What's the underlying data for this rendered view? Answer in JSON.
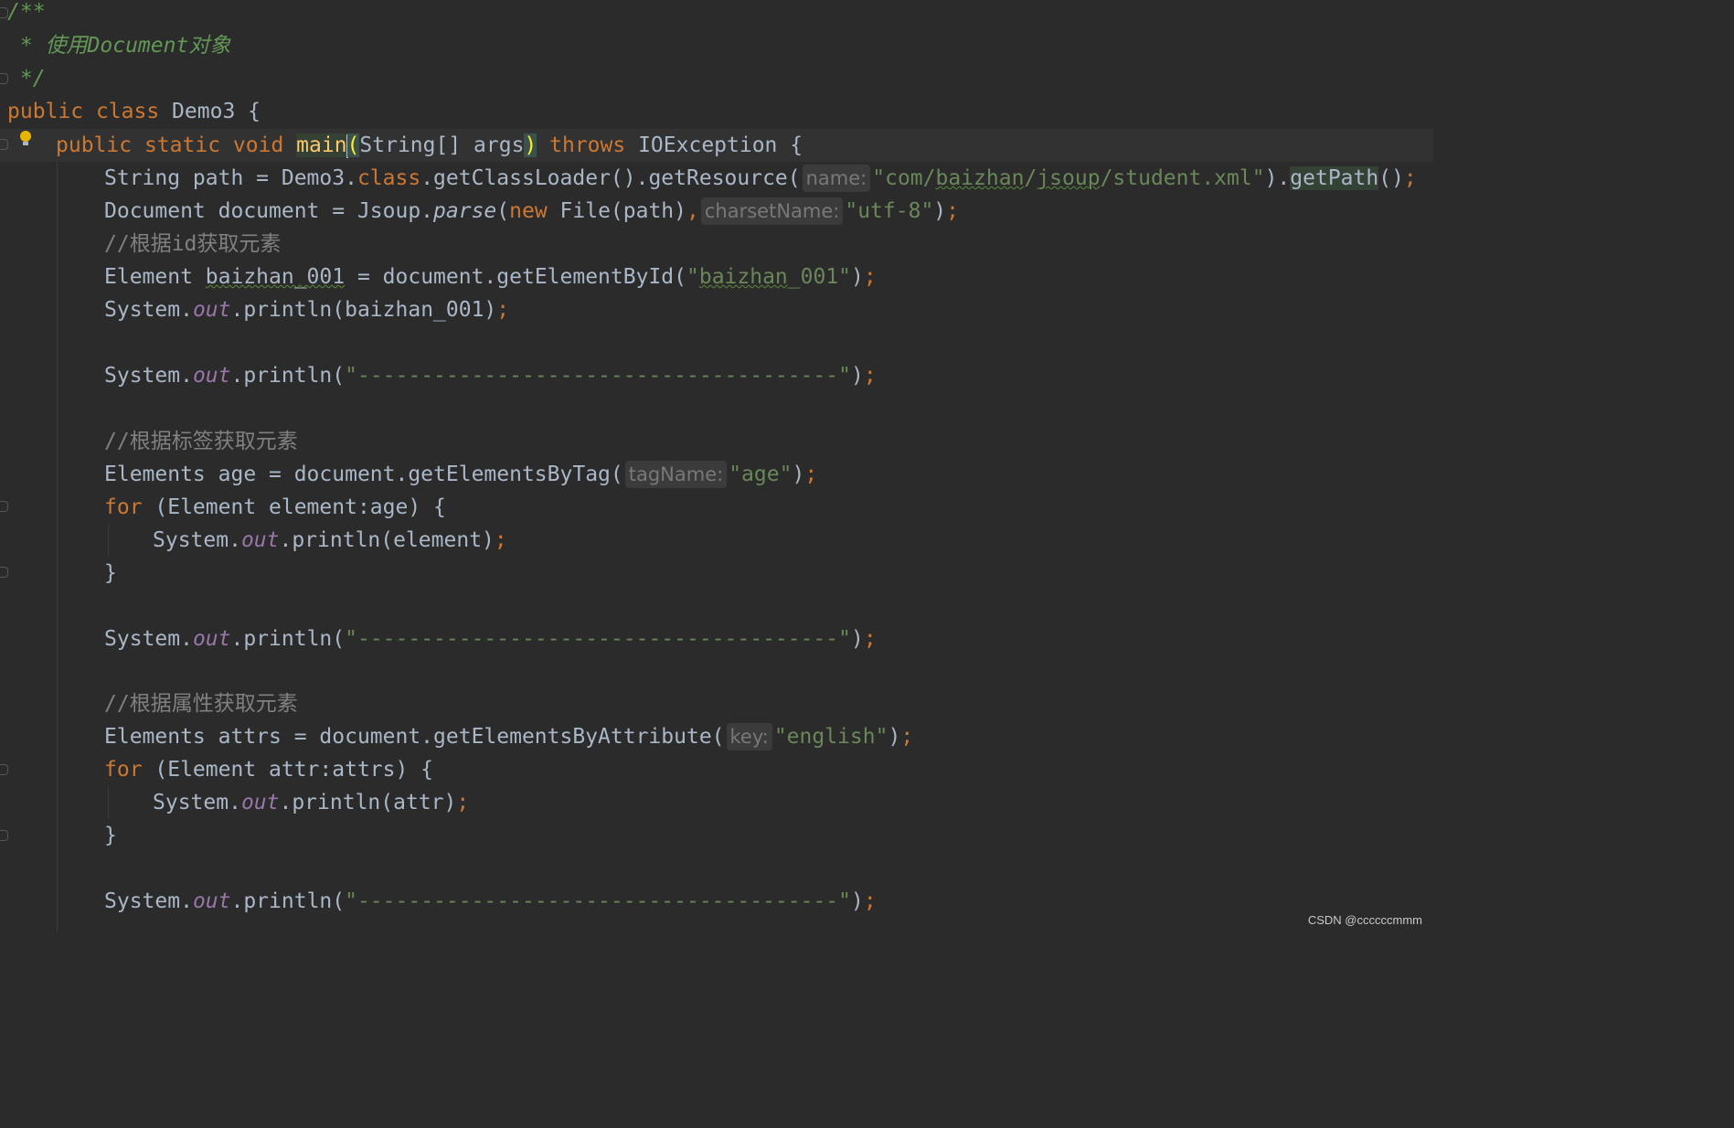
{
  "lines": {
    "l1": "/**",
    "l2": " * 使用Document对象",
    "l3": " */",
    "l4_kw1": "public",
    "l4_kw2": "class",
    "l4_rest": " Demo3 {",
    "l5_kw1": "public",
    "l5_kw2": "static",
    "l5_kw3": "void",
    "l5_method": "main",
    "l5_open": "(",
    "l5_params": "String[] args",
    "l5_close": ")",
    "l5_throws": "throws",
    "l5_rest": " IOException {",
    "l6_a": "String path = Demo3.",
    "l6_class": "class",
    "l6_b": ".getClassLoader().getResource(",
    "l6_hint": "name:",
    "l6_str_a": "\"com/",
    "l6_str_b": "baizhan",
    "l6_str_c": "/",
    "l6_str_d": "jsoup",
    "l6_str_e": "/student.xml\"",
    "l6_c": ").",
    "l6_getpath": "getPath",
    "l6_d": "()",
    "l6_semi": ";",
    "l7_a": "Document document = Jsoup.",
    "l7_parse": "parse",
    "l7_b": "(",
    "l7_new": "new",
    "l7_c": " File(path)",
    "l7_comma": ",",
    "l7_hint": "charsetName:",
    "l7_str": "\"utf-8\"",
    "l7_d": ")",
    "l7_semi": ";",
    "l8": "//根据id获取元素",
    "l9_a": "Element ",
    "l9_var": "baizhan_001",
    "l9_b": " = document.getElementById(",
    "l9_str_a": "\"",
    "l9_str_b": "baizhan",
    "l9_str_c": "_001\"",
    "l9_c": ")",
    "l9_semi": ";",
    "l10_a": "System.",
    "l10_out": "out",
    "l10_b": ".println(baizhan_001)",
    "l10_semi": ";",
    "l12_a": "System.",
    "l12_out": "out",
    "l12_b": ".println(",
    "l12_str": "\"--------------------------------------\"",
    "l12_c": ")",
    "l12_semi": ";",
    "l14": "//根据标签获取元素",
    "l15_a": "Elements age = document.getElementsByTag(",
    "l15_hint": "tagName:",
    "l15_str": "\"age\"",
    "l15_b": ")",
    "l15_semi": ";",
    "l16_for": "for",
    "l16_rest": " (Element element:age) {",
    "l17_a": "System.",
    "l17_out": "out",
    "l17_b": ".println(element)",
    "l17_semi": ";",
    "l18": "}",
    "l20_a": "System.",
    "l20_out": "out",
    "l20_b": ".println(",
    "l20_str": "\"--------------------------------------\"",
    "l20_c": ")",
    "l20_semi": ";",
    "l22": "//根据属性获取元素",
    "l23_a": "Elements attrs = document.getElementsByAttribute(",
    "l23_hint": "key:",
    "l23_str": "\"english\"",
    "l23_b": ")",
    "l23_semi": ";",
    "l24_for": "for",
    "l24_rest": " (Element attr:attrs) {",
    "l25_a": "System.",
    "l25_out": "out",
    "l25_b": ".println(attr)",
    "l25_semi": ";",
    "l26": "}",
    "l28_a": "System.",
    "l28_out": "out",
    "l28_b": ".println(",
    "l28_str": "\"--------------------------------------\"",
    "l28_c": ")",
    "l28_semi": ";"
  },
  "watermark": "CSDN @ccccccmmm",
  "colors": {
    "background": "#2b2b2b",
    "keyword": "#cc7832",
    "string": "#6a8759",
    "comment": "#808080",
    "doc_comment": "#629755",
    "field": "#9876aa",
    "method_decl": "#ffc66d",
    "default_text": "#a9b7c6"
  },
  "icons": [
    "lightbulb-icon",
    "fold-marker-icon"
  ]
}
